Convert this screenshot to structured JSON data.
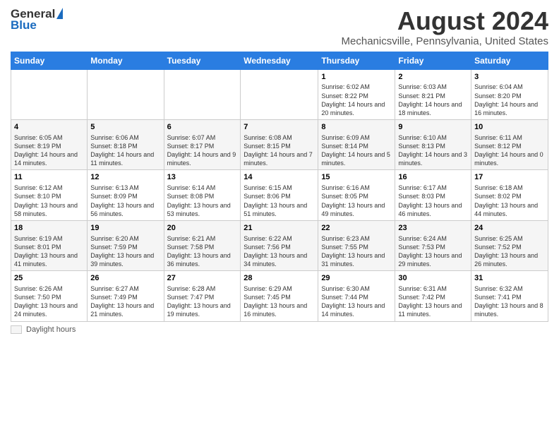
{
  "logo": {
    "general": "General",
    "blue": "Blue"
  },
  "title": "August 2024",
  "subtitle": "Mechanicsville, Pennsylvania, United States",
  "days_of_week": [
    "Sunday",
    "Monday",
    "Tuesday",
    "Wednesday",
    "Thursday",
    "Friday",
    "Saturday"
  ],
  "footer": {
    "label": "Daylight hours"
  },
  "weeks": [
    [
      {
        "day": "",
        "info": ""
      },
      {
        "day": "",
        "info": ""
      },
      {
        "day": "",
        "info": ""
      },
      {
        "day": "",
        "info": ""
      },
      {
        "day": "1",
        "info": "Sunrise: 6:02 AM\nSunset: 8:22 PM\nDaylight: 14 hours and 20 minutes."
      },
      {
        "day": "2",
        "info": "Sunrise: 6:03 AM\nSunset: 8:21 PM\nDaylight: 14 hours and 18 minutes."
      },
      {
        "day": "3",
        "info": "Sunrise: 6:04 AM\nSunset: 8:20 PM\nDaylight: 14 hours and 16 minutes."
      }
    ],
    [
      {
        "day": "4",
        "info": "Sunrise: 6:05 AM\nSunset: 8:19 PM\nDaylight: 14 hours and 14 minutes."
      },
      {
        "day": "5",
        "info": "Sunrise: 6:06 AM\nSunset: 8:18 PM\nDaylight: 14 hours and 11 minutes."
      },
      {
        "day": "6",
        "info": "Sunrise: 6:07 AM\nSunset: 8:17 PM\nDaylight: 14 hours and 9 minutes."
      },
      {
        "day": "7",
        "info": "Sunrise: 6:08 AM\nSunset: 8:15 PM\nDaylight: 14 hours and 7 minutes."
      },
      {
        "day": "8",
        "info": "Sunrise: 6:09 AM\nSunset: 8:14 PM\nDaylight: 14 hours and 5 minutes."
      },
      {
        "day": "9",
        "info": "Sunrise: 6:10 AM\nSunset: 8:13 PM\nDaylight: 14 hours and 3 minutes."
      },
      {
        "day": "10",
        "info": "Sunrise: 6:11 AM\nSunset: 8:12 PM\nDaylight: 14 hours and 0 minutes."
      }
    ],
    [
      {
        "day": "11",
        "info": "Sunrise: 6:12 AM\nSunset: 8:10 PM\nDaylight: 13 hours and 58 minutes."
      },
      {
        "day": "12",
        "info": "Sunrise: 6:13 AM\nSunset: 8:09 PM\nDaylight: 13 hours and 56 minutes."
      },
      {
        "day": "13",
        "info": "Sunrise: 6:14 AM\nSunset: 8:08 PM\nDaylight: 13 hours and 53 minutes."
      },
      {
        "day": "14",
        "info": "Sunrise: 6:15 AM\nSunset: 8:06 PM\nDaylight: 13 hours and 51 minutes."
      },
      {
        "day": "15",
        "info": "Sunrise: 6:16 AM\nSunset: 8:05 PM\nDaylight: 13 hours and 49 minutes."
      },
      {
        "day": "16",
        "info": "Sunrise: 6:17 AM\nSunset: 8:03 PM\nDaylight: 13 hours and 46 minutes."
      },
      {
        "day": "17",
        "info": "Sunrise: 6:18 AM\nSunset: 8:02 PM\nDaylight: 13 hours and 44 minutes."
      }
    ],
    [
      {
        "day": "18",
        "info": "Sunrise: 6:19 AM\nSunset: 8:01 PM\nDaylight: 13 hours and 41 minutes."
      },
      {
        "day": "19",
        "info": "Sunrise: 6:20 AM\nSunset: 7:59 PM\nDaylight: 13 hours and 39 minutes."
      },
      {
        "day": "20",
        "info": "Sunrise: 6:21 AM\nSunset: 7:58 PM\nDaylight: 13 hours and 36 minutes."
      },
      {
        "day": "21",
        "info": "Sunrise: 6:22 AM\nSunset: 7:56 PM\nDaylight: 13 hours and 34 minutes."
      },
      {
        "day": "22",
        "info": "Sunrise: 6:23 AM\nSunset: 7:55 PM\nDaylight: 13 hours and 31 minutes."
      },
      {
        "day": "23",
        "info": "Sunrise: 6:24 AM\nSunset: 7:53 PM\nDaylight: 13 hours and 29 minutes."
      },
      {
        "day": "24",
        "info": "Sunrise: 6:25 AM\nSunset: 7:52 PM\nDaylight: 13 hours and 26 minutes."
      }
    ],
    [
      {
        "day": "25",
        "info": "Sunrise: 6:26 AM\nSunset: 7:50 PM\nDaylight: 13 hours and 24 minutes."
      },
      {
        "day": "26",
        "info": "Sunrise: 6:27 AM\nSunset: 7:49 PM\nDaylight: 13 hours and 21 minutes."
      },
      {
        "day": "27",
        "info": "Sunrise: 6:28 AM\nSunset: 7:47 PM\nDaylight: 13 hours and 19 minutes."
      },
      {
        "day": "28",
        "info": "Sunrise: 6:29 AM\nSunset: 7:45 PM\nDaylight: 13 hours and 16 minutes."
      },
      {
        "day": "29",
        "info": "Sunrise: 6:30 AM\nSunset: 7:44 PM\nDaylight: 13 hours and 14 minutes."
      },
      {
        "day": "30",
        "info": "Sunrise: 6:31 AM\nSunset: 7:42 PM\nDaylight: 13 hours and 11 minutes."
      },
      {
        "day": "31",
        "info": "Sunrise: 6:32 AM\nSunset: 7:41 PM\nDaylight: 13 hours and 8 minutes."
      }
    ]
  ]
}
